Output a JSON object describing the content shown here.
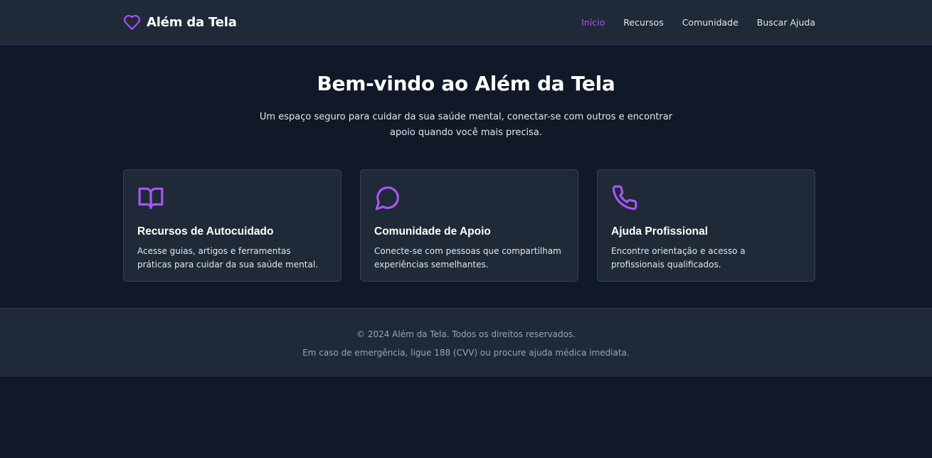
{
  "header": {
    "brand": {
      "name": "Além da Tela",
      "icon": "heart-icon"
    },
    "nav": [
      {
        "label": "Início",
        "active": true
      },
      {
        "label": "Recursos",
        "active": false
      },
      {
        "label": "Comunidade",
        "active": false
      },
      {
        "label": "Buscar Ajuda",
        "active": false
      }
    ]
  },
  "hero": {
    "title": "Bem-vindo ao Além da Tela",
    "subtitle": "Um espaço seguro para cuidar da sua saúde mental, conectar-se com outros e encontrar apoio quando você mais precisa."
  },
  "cards": [
    {
      "icon": "book-icon",
      "title": "Recursos de Autocuidado",
      "description": "Acesse guias, artigos e ferramentas práticas para cuidar da sua saúde mental."
    },
    {
      "icon": "chat-bubble-icon",
      "title": "Comunidade de Apoio",
      "description": "Conecte-se com pessoas que compartilham experiências semelhantes."
    },
    {
      "icon": "phone-icon",
      "title": "Ajuda Profissional",
      "description": "Encontre orientação e acesso a profissionais qualificados."
    }
  ],
  "footer": {
    "copyright": "© 2024 Além da Tela. Todos os direitos reservados.",
    "emergency": "Em caso de emergência, ligue 188 (CVV) ou procure ajuda médica imediata."
  },
  "colors": {
    "accent": "#a855f7",
    "background": "#111827",
    "surface": "#1f2937",
    "border": "#374151",
    "text": "#ffffff",
    "muted": "#9ca3af"
  }
}
